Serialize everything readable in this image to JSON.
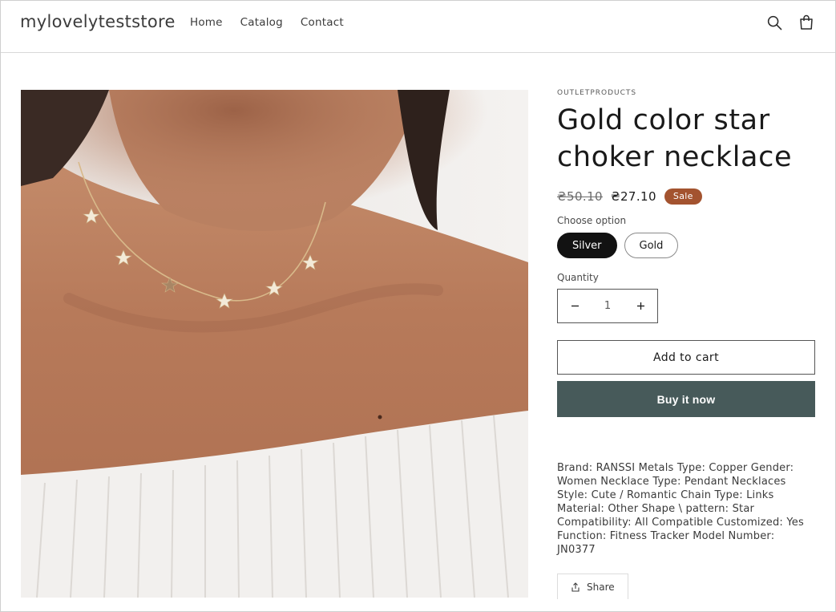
{
  "header": {
    "logo": "mylovelyteststore",
    "nav": [
      {
        "label": "Home"
      },
      {
        "label": "Catalog"
      },
      {
        "label": "Contact"
      }
    ],
    "icons": {
      "search": "search-icon",
      "cart": "cart-icon"
    }
  },
  "product": {
    "image": {
      "subject": "woman wearing star choker necklace"
    },
    "vendor": "OUTLETPRODUCTS",
    "title": "Gold color star choker necklace",
    "price_compare": "₴50.10",
    "price": "₴27.10",
    "badge": "Sale",
    "option_label": "Choose option",
    "options": [
      {
        "label": "Silver",
        "selected": true
      },
      {
        "label": "Gold",
        "selected": false
      }
    ],
    "quantity_label": "Quantity",
    "quantity": "1",
    "add_to_cart": "Add to cart",
    "buy_now": "Buy it now",
    "description": "Brand: RANSSI Metals Type: Copper Gender: Women Necklace Type: Pendant Necklaces Style: Cute / Romantic Chain Type: Links Material: Other Shape \\ pattern: Star Compatibility: All Compatible Customized: Yes Function: Fitness Tracker Model Number: JN0377",
    "share": "Share"
  },
  "colors": {
    "badge": "#a3532f",
    "buy_now": "#475a5a",
    "selected_pill": "#121212"
  }
}
